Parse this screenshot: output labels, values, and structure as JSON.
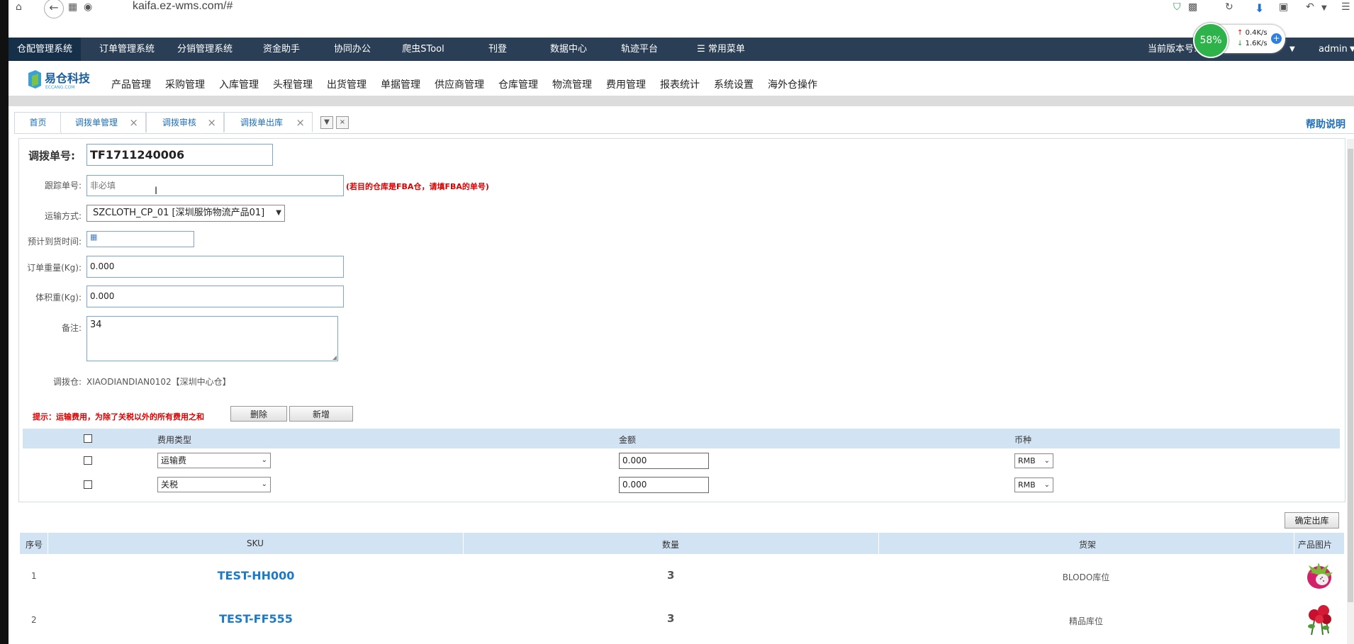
{
  "browser": {
    "url": "kaifa.ez-wms.com/#"
  },
  "net_widget": {
    "percent": "58%",
    "up": "0.4K/s",
    "down": "1.6K/s"
  },
  "sysnav": {
    "items": [
      "仓配管理系统",
      "订单管理系统",
      "分销管理系统",
      "资金助手",
      "协同办公",
      "爬虫STool",
      "刊登",
      "数据中心",
      "轨迹平台",
      "常用菜单"
    ],
    "version_label": "当前版本号:D",
    "user": "admin"
  },
  "modules": [
    "产品管理",
    "采购管理",
    "入库管理",
    "头程管理",
    "出货管理",
    "单据管理",
    "供应商管理",
    "仓库管理",
    "物流管理",
    "费用管理",
    "报表统计",
    "系统设置",
    "海外仓操作"
  ],
  "logo": {
    "text": "易仓科技",
    "sub": "ECCANG.COM"
  },
  "tabs": [
    {
      "label": "首页",
      "closable": false
    },
    {
      "label": "调拨单管理",
      "closable": true
    },
    {
      "label": "调拨审核",
      "closable": true
    },
    {
      "label": "调拨单出库",
      "closable": true
    }
  ],
  "help_label": "帮助说明",
  "form": {
    "order_no_label": "调拨单号:",
    "order_no": "TF1711240006",
    "tracking_label": "跟踪单号:",
    "tracking_placeholder": "非必填",
    "tracking_hint": "(若目的仓库是FBA仓，请填FBA的单号)",
    "shipping_label": "运输方式:",
    "shipping_value": "SZCLOTH_CP_01 [深圳服饰物流产品01]",
    "eta_label": "预计到货时间:",
    "weight_label": "订单重量(Kg):",
    "weight_value": "0.000",
    "volume_label": "体积重(Kg):",
    "volume_value": "0.000",
    "remark_label": "备注:",
    "remark_value": "34",
    "warehouse_label": "调拨仓:",
    "warehouse_value": "XIAODIANDIAN0102【深圳中心仓】"
  },
  "fees": {
    "tip": "提示：运输费用，为除了关税以外的所有费用之和",
    "delete_label": "删除",
    "add_label": "新增",
    "headers": {
      "type": "费用类型",
      "amount": "金额",
      "currency": "币种"
    },
    "rows": [
      {
        "type": "运输费",
        "amount": "0.000",
        "currency": "RMB"
      },
      {
        "type": "关税",
        "amount": "0.000",
        "currency": "RMB"
      }
    ]
  },
  "confirm_label": "确定出库",
  "items": {
    "headers": {
      "seq": "序号",
      "sku": "SKU",
      "qty": "数量",
      "location": "货架",
      "image": "产品图片"
    },
    "rows": [
      {
        "seq": "1",
        "sku": "TEST-HH000",
        "qty": "3",
        "location": "BLODO库位",
        "image": "dragonfruit"
      },
      {
        "seq": "2",
        "sku": "TEST-FF555",
        "qty": "3",
        "location": "精品库位",
        "image": "roses"
      }
    ]
  }
}
